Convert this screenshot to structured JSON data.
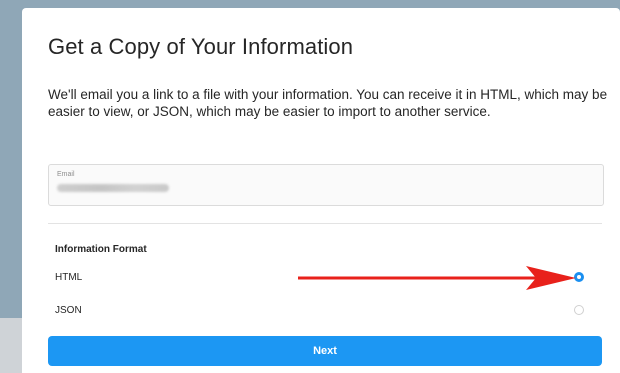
{
  "dialog": {
    "title": "Get a Copy of Your Information",
    "description": "We'll email you a link to a file with your information. You can receive it in HTML, which may be easier to view, or JSON, which may be easier to import to another service."
  },
  "email": {
    "label": "Email",
    "value_state": "blurred"
  },
  "format": {
    "section_label": "Information Format",
    "options": [
      {
        "label": "HTML",
        "selected": true
      },
      {
        "label": "JSON",
        "selected": false
      }
    ]
  },
  "annotation": {
    "arrow_color": "#e8211b",
    "points_to": "HTML radio button"
  },
  "actions": {
    "next_label": "Next"
  },
  "colors": {
    "accent": "#1c97f3",
    "text": "#262626",
    "backdrop": "#8fa7b7"
  }
}
